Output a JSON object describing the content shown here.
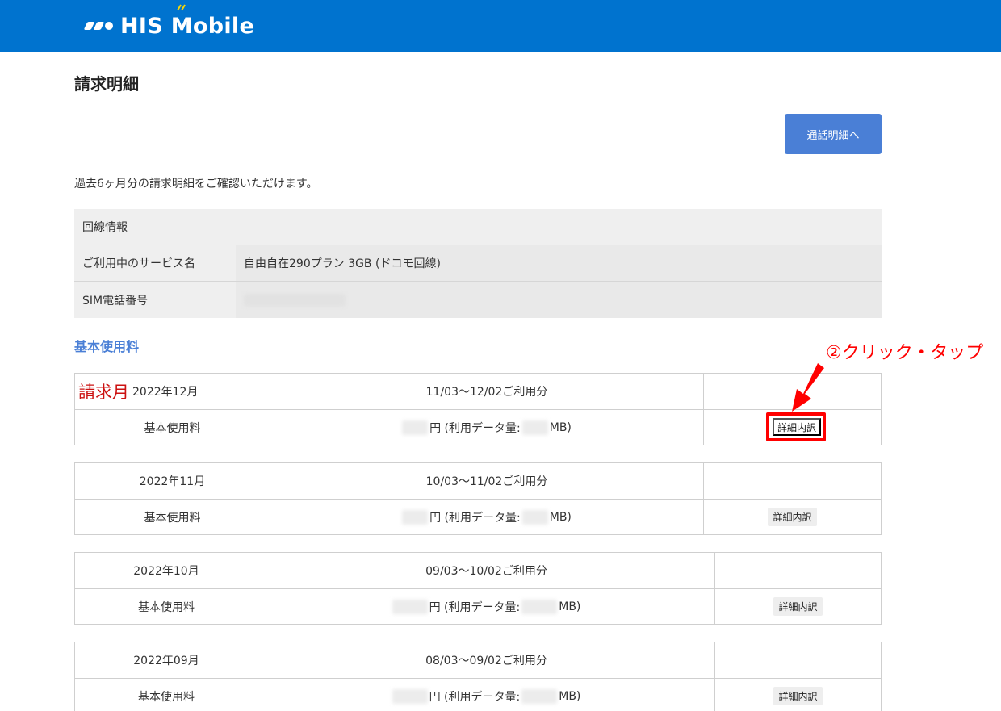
{
  "header": {
    "logo_text": "HIS Mobile"
  },
  "page": {
    "title": "請求明細",
    "call_detail_button": "通話明細へ",
    "intro": "過去6ヶ月分の請求明細をご確認いただけます。"
  },
  "line_info": {
    "heading": "回線情報",
    "service_label": "ご利用中のサービス名",
    "service_value": "自由自在290プラン 3GB (ドコモ回線)",
    "sim_label": "SIM電話番号"
  },
  "section_title": "基本使用料",
  "annotation": {
    "label": "請求月",
    "instruction": "②クリック・タップ"
  },
  "bills": [
    {
      "month": "2022年12月",
      "period": "11/03～12/02ご利用分",
      "fee_label": "基本使用料",
      "yen_text": "円 (利用データ量:",
      "mb_text": "MB)",
      "detail_button": "詳細内訳"
    },
    {
      "month": "2022年11月",
      "period": "10/03～11/02ご利用分",
      "fee_label": "基本使用料",
      "yen_text": "円 (利用データ量:",
      "mb_text": "MB)",
      "detail_button": "詳細内訳"
    },
    {
      "month": "2022年10月",
      "period": "09/03～10/02ご利用分",
      "fee_label": "基本使用料",
      "yen_text": "円 (利用データ量:",
      "mb_text": "MB)",
      "detail_button": "詳細内訳"
    },
    {
      "month": "2022年09月",
      "period": "08/03～09/02ご利用分",
      "fee_label": "基本使用料",
      "yen_text": "円 (利用データ量:",
      "mb_text": "MB)",
      "detail_button": "詳細内訳"
    }
  ]
}
